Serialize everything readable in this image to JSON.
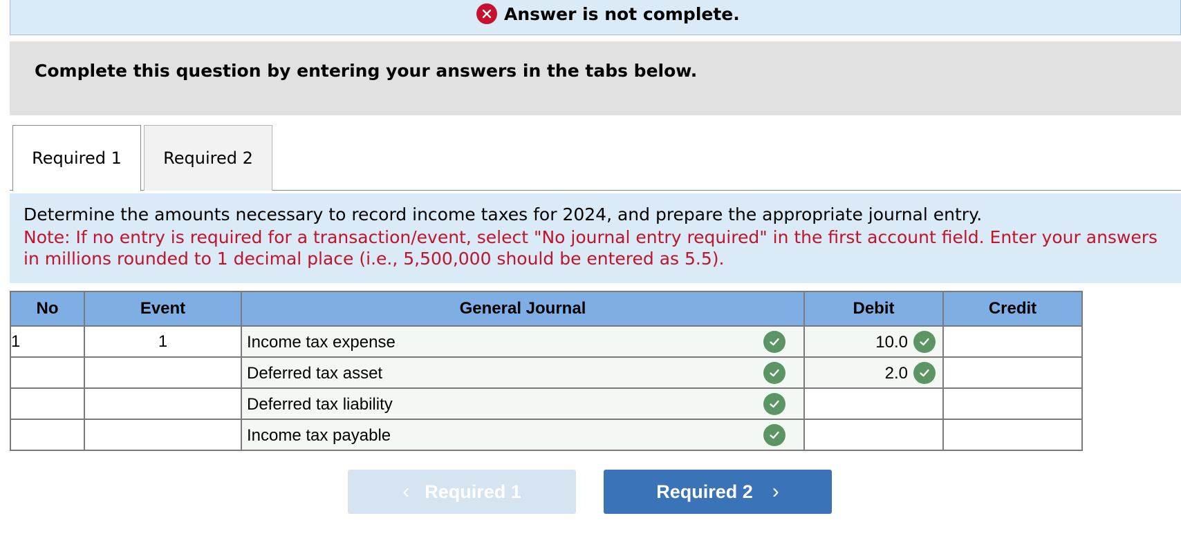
{
  "banner": {
    "text": "Answer is not complete.",
    "icon": "x-circle-icon",
    "icon_color": "#c8102e"
  },
  "instructions": {
    "text": "Complete this question by entering your answers in the tabs below."
  },
  "tabs": [
    {
      "label": "Required 1",
      "active": true
    },
    {
      "label": "Required 2",
      "active": false
    }
  ],
  "question": {
    "main": "Determine the amounts necessary to record income taxes for 2024, and prepare the appropriate journal entry.",
    "note": "Note: If no entry is required for a transaction/event, select \"No journal entry required\" in the first account field. Enter your answers in millions rounded to 1 decimal place (i.e., 5,500,000 should be entered as 5.5)."
  },
  "journal": {
    "headers": {
      "no": "No",
      "event": "Event",
      "general_journal": "General Journal",
      "debit": "Debit",
      "credit": "Credit"
    },
    "rows": [
      {
        "no": "1",
        "event": "1",
        "account": "Income tax expense",
        "debit": "10.0",
        "credit": "",
        "account_correct": true,
        "debit_correct": true
      },
      {
        "no": "",
        "event": "",
        "account": "Deferred tax asset",
        "debit": "2.0",
        "credit": "",
        "account_correct": true,
        "debit_correct": true
      },
      {
        "no": "",
        "event": "",
        "account": "Deferred tax liability",
        "debit": "",
        "credit": "",
        "account_correct": true,
        "debit_correct": false
      },
      {
        "no": "",
        "event": "",
        "account": "Income tax payable",
        "debit": "",
        "credit": "",
        "account_correct": true,
        "debit_correct": false
      }
    ],
    "check_color": "#5b9563",
    "header_color": "#7eaee3"
  },
  "nav": {
    "prev_label": "Required 1",
    "next_label": "Required 2",
    "prev_color": "#d6e3f1",
    "next_color": "#3a73b8"
  }
}
